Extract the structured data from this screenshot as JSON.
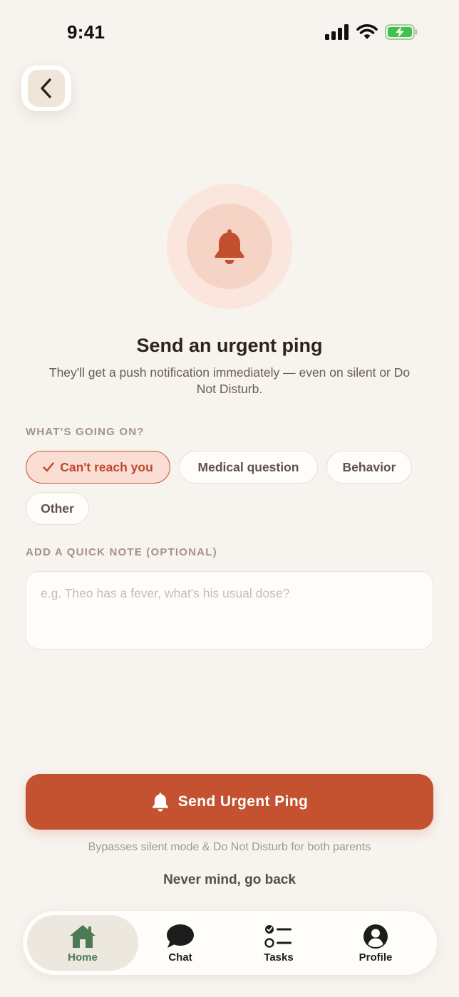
{
  "status_bar": {
    "time": "9:41"
  },
  "hero": {
    "title": "Send an urgent ping",
    "subtitle": "They'll get a push notification immediately — even on silent or Do Not Disturb."
  },
  "reason": {
    "label": "WHAT'S GOING ON?",
    "options": [
      {
        "label": "Can't reach you",
        "selected": true
      },
      {
        "label": "Medical question",
        "selected": false
      },
      {
        "label": "Behavior",
        "selected": false
      },
      {
        "label": "Other",
        "selected": false
      }
    ]
  },
  "note": {
    "label": "ADD A QUICK NOTE (OPTIONAL)",
    "value": "",
    "placeholder": "e.g. Theo has a fever, what's his usual dose?"
  },
  "actions": {
    "send_label": "Send Urgent Ping",
    "bypass_note": "Bypasses silent mode & Do Not Disturb for both parents",
    "back_label": "Never mind, go back"
  },
  "tabbar": {
    "items": [
      {
        "label": "Home",
        "icon": "home-icon",
        "active": true
      },
      {
        "label": "Chat",
        "icon": "chat-icon",
        "active": false
      },
      {
        "label": "Tasks",
        "icon": "tasks-icon",
        "active": false
      },
      {
        "label": "Profile",
        "icon": "profile-icon",
        "active": false
      }
    ]
  },
  "colors": {
    "accent": "#c4512f",
    "background": "#f7f3ee",
    "active_tab": "#4d7a55"
  }
}
